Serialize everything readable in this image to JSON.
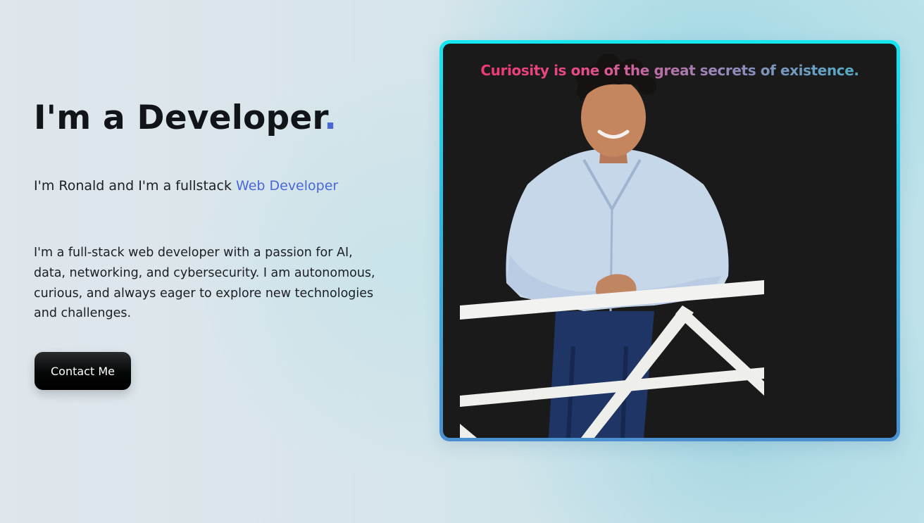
{
  "hero": {
    "headline_text": "I'm a Developer",
    "headline_dot": ".",
    "intro_prefix": "I'm Ronald and I'm a fullstack ",
    "intro_role": "Web Developer",
    "bio": "I'm a full-stack web developer with a passion for AI, data, networking, and cybersecurity. I am autonomous, curious, and always eager to explore new technologies and challenges.",
    "contact_button_label": "Contact Me"
  },
  "photo": {
    "quote": "Curiosity is one of the great secrets of existence."
  },
  "colors": {
    "accent": "#4a67d6",
    "button_bg": "#050606",
    "card_border_top": "#16e7ef",
    "card_border_bottom": "#4b8fd0",
    "photo_bg": "#1a1a1b"
  }
}
